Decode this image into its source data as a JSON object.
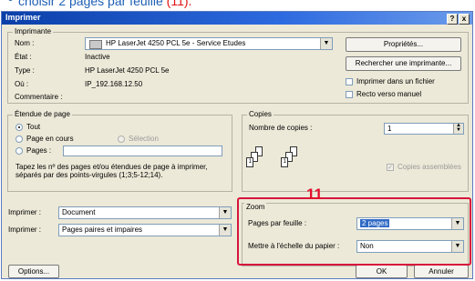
{
  "caption": {
    "text": "choisir 2 pages par feuille",
    "number": "(11)."
  },
  "window": {
    "title": "Imprimer",
    "help": "?",
    "close": "x"
  },
  "printer": {
    "group_label": "Imprimante",
    "name_label": "Nom :",
    "name_value": "HP LaserJet 4250 PCL 5e - Service Etudes",
    "status_label": "État :",
    "status_value": "Inactive",
    "type_label": "Type :",
    "type_value": "HP LaserJet 4250 PCL 5e",
    "where_label": "Où :",
    "where_value": "IP_192.168.12.50",
    "comment_label": "Commentaire :",
    "properties_button": "Propriétés...",
    "find_button": "Rechercher une imprimante...",
    "print_to_file": "Imprimer dans un fichier",
    "duplex": "Recto verso manuel"
  },
  "range": {
    "group_label": "Étendue de page",
    "all": "Tout",
    "current": "Page en cours",
    "selection": "Sélection",
    "pages": "Pages :",
    "hint": "Tapez les nº des pages et/ou étendues de page à imprimer, séparés par des points-virgules (1;3;5-12;14)."
  },
  "copies": {
    "group_label": "Copies",
    "count_label": "Nombre de copies :",
    "count_value": "1",
    "collate": "Copies assemblées"
  },
  "print_what": {
    "label": "Imprimer :",
    "value": "Document"
  },
  "print_sel": {
    "label": "Imprimer :",
    "value": "Pages paires et impaires"
  },
  "zoom": {
    "group_label": "Zoom",
    "pages_label": "Pages par feuille :",
    "pages_value": "2 pages",
    "scale_label": "Mettre à l'échelle du papier :",
    "scale_value": "Non",
    "annotation": "11"
  },
  "footer": {
    "options": "Options...",
    "ok": "OK",
    "cancel": "Annuler"
  }
}
